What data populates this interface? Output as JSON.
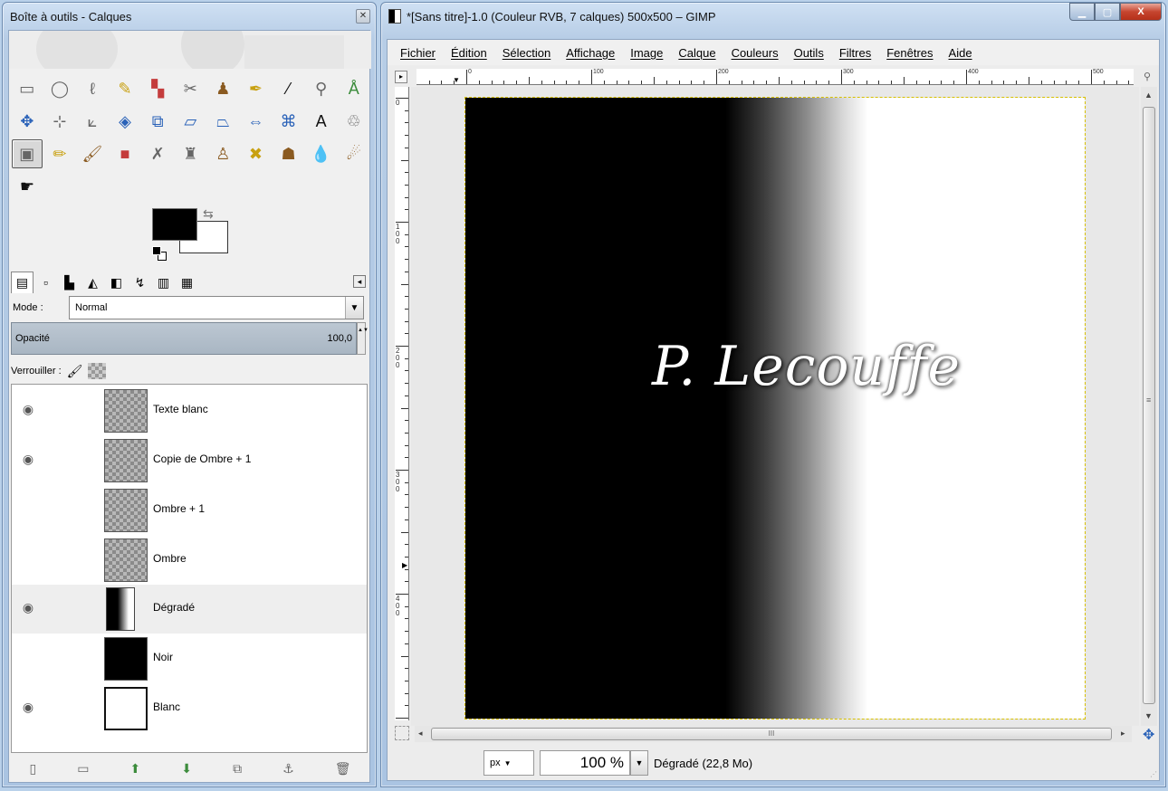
{
  "toolbox": {
    "title": "Boîte à outils - Calques",
    "close_glyph": "✕",
    "tool_rows": [
      [
        {
          "icon": "rect-select-icon",
          "g": "▭",
          "c": "t-gray"
        },
        {
          "icon": "ellipse-select-icon",
          "g": "◯",
          "c": "t-gray"
        },
        {
          "icon": "free-select-icon",
          "g": "ℓ",
          "c": "t-gray"
        },
        {
          "icon": "fuzzy-select-icon",
          "g": "✎",
          "c": "t-yellow"
        },
        {
          "icon": "color-select-icon",
          "g": "▚",
          "c": "t-red"
        },
        {
          "icon": "scissors-icon",
          "g": "✂",
          "c": "t-gray"
        },
        {
          "icon": "foreground-select-icon",
          "g": "♟",
          "c": "t-brown"
        },
        {
          "icon": "paths-icon",
          "g": "✒",
          "c": "t-yellow"
        },
        {
          "icon": "color-picker-icon",
          "g": "⁄",
          "c": "t-black"
        },
        {
          "icon": "zoom-icon",
          "g": "⚲",
          "c": "t-gray"
        },
        {
          "icon": "measure-icon",
          "g": "Å",
          "c": "t-green"
        }
      ],
      [
        {
          "icon": "move-icon",
          "g": "✥",
          "c": "t-blue"
        },
        {
          "icon": "align-icon",
          "g": "⊹",
          "c": "t-gray"
        },
        {
          "icon": "crop-icon",
          "g": "⟀",
          "c": "t-gray"
        },
        {
          "icon": "rotate-icon",
          "g": "◈",
          "c": "t-blue"
        },
        {
          "icon": "scale-icon",
          "g": "⧉",
          "c": "t-blue"
        },
        {
          "icon": "shear-icon",
          "g": "▱",
          "c": "t-blue"
        },
        {
          "icon": "perspective-icon",
          "g": "⏢",
          "c": "t-blue"
        },
        {
          "icon": "flip-icon",
          "g": "⇔",
          "c": "t-blue"
        },
        {
          "icon": "cage-icon",
          "g": "⌘",
          "c": "t-blue"
        },
        {
          "icon": "text-icon",
          "g": "A",
          "c": "t-black"
        },
        {
          "icon": "bucket-icon",
          "g": "♲",
          "c": "t-gray"
        }
      ],
      [
        {
          "icon": "gradient-icon",
          "g": "▣",
          "c": "t-gray",
          "active": true
        },
        {
          "icon": "pencil-icon",
          "g": "✏",
          "c": "t-yellow"
        },
        {
          "icon": "paintbrush-icon",
          "g": "🖌",
          "c": "t-brown"
        },
        {
          "icon": "eraser-icon",
          "g": "■",
          "c": "t-red"
        },
        {
          "icon": "airbrush-icon",
          "g": "✗",
          "c": "t-gray"
        },
        {
          "icon": "ink-icon",
          "g": "♜",
          "c": "t-gray"
        },
        {
          "icon": "clone-icon",
          "g": "♙",
          "c": "t-brown"
        },
        {
          "icon": "heal-icon",
          "g": "✖",
          "c": "t-yellow"
        },
        {
          "icon": "perspective-clone-icon",
          "g": "☗",
          "c": "t-brown"
        },
        {
          "icon": "blur-icon",
          "g": "💧",
          "c": "t-blue"
        },
        {
          "icon": "smudge-icon",
          "g": "☄",
          "c": "t-brown"
        }
      ],
      [
        {
          "icon": "dodge-burn-icon",
          "g": "☛",
          "c": "t-black"
        }
      ]
    ],
    "swap_glyph": "⇆",
    "dock_tabs": [
      {
        "icon": "layers-tab-icon",
        "g": "▤",
        "active": true
      },
      {
        "icon": "channels-tab-icon",
        "g": "▫"
      },
      {
        "icon": "paths-tab-icon",
        "g": "▙"
      },
      {
        "icon": "histogram-tab-icon",
        "g": "◭"
      },
      {
        "icon": "gradients-tab-icon",
        "g": "◧"
      },
      {
        "icon": "undo-tab-icon",
        "g": "↯"
      },
      {
        "icon": "palette-tab-icon",
        "g": "▥"
      },
      {
        "icon": "tool-options-tab-icon",
        "g": "▦"
      }
    ],
    "dock_menu_glyph": "◂",
    "mode_label": "Mode :",
    "mode_value": "Normal",
    "combo_arrow": "▼",
    "opacity_label": "Opacité",
    "opacity_value": "100,0",
    "spin_glyph": "▲▼",
    "lock_label": "Verrouiller :",
    "lock_brush_glyph": "🖌",
    "layers": [
      {
        "name": "Texte blanc",
        "visible": true,
        "thumb": "checker"
      },
      {
        "name": "Copie de Ombre + 1",
        "visible": true,
        "thumb": "checker"
      },
      {
        "name": "Ombre + 1",
        "visible": false,
        "thumb": "checker"
      },
      {
        "name": "Ombre",
        "visible": false,
        "thumb": "checker"
      },
      {
        "name": "Dégradé",
        "visible": true,
        "thumb": "grad",
        "selected": true
      },
      {
        "name": "Noir",
        "visible": false,
        "thumb": "black"
      },
      {
        "name": "Blanc",
        "visible": true,
        "thumb": "white"
      }
    ],
    "eye_glyph": "◉",
    "layer_buttons": [
      {
        "icon": "new-layer-icon",
        "g": "▯"
      },
      {
        "icon": "new-group-icon",
        "g": "▭"
      },
      {
        "icon": "raise-layer-icon",
        "g": "⬆"
      },
      {
        "icon": "lower-layer-icon",
        "g": "⬇"
      },
      {
        "icon": "duplicate-layer-icon",
        "g": "⧉"
      },
      {
        "icon": "anchor-layer-icon",
        "g": "⚓"
      },
      {
        "icon": "delete-layer-icon",
        "g": "🗑"
      }
    ]
  },
  "main": {
    "title": "*[Sans titre]-1.0 (Couleur RVB, 7 calques) 500x500 – GIMP",
    "caption": {
      "min": "▁",
      "max": "▢",
      "close": "X"
    },
    "menus": [
      "Fichier",
      "Édition",
      "Sélection",
      "Affichage",
      "Image",
      "Calque",
      "Couleurs",
      "Outils",
      "Filtres",
      "Fenêtres",
      "Aide"
    ],
    "ruler_h_labels": [
      "0",
      "100",
      "200",
      "300",
      "400",
      "500"
    ],
    "ruler_v_labels": [
      "0",
      "100",
      "200",
      "300",
      "400"
    ],
    "ruler_corner_glyph": "▸",
    "zoom_glyph": "⚲",
    "signature": "P. Lecouffe",
    "scroll_up": "▲",
    "scroll_down": "▼",
    "scroll_left": "◂",
    "scroll_right": "▸",
    "grip_v": "≡",
    "grip_h": "III",
    "nav_glyph": "✥",
    "unit": "px",
    "unit_arrow": "▼",
    "zoom": "100 %",
    "zoom_arrow": "▼",
    "status": "Dégradé (22,8 Mo)",
    "resize_glyph": "⋰"
  }
}
